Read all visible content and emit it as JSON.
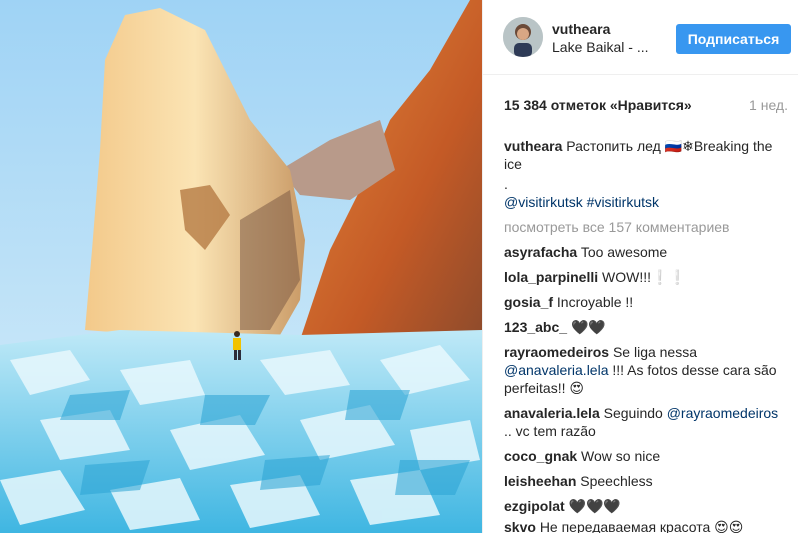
{
  "post": {
    "username": "vutheara",
    "location": "Lake Baikal - ...",
    "follow_label": "Подписаться",
    "likes": "15 384 отметок «Нравится»",
    "time_ago": "1 нед.",
    "caption_text": "Растопить лед 🇷🇺❄Breaking the ice",
    "caption_dot": ".",
    "hashtags": "@visitirkutsk #visitirkutsk",
    "view_all": "посмотреть все 157 комментариев"
  },
  "comments": [
    {
      "user": "asyrafacha",
      "text": "Too awesome"
    },
    {
      "user": "lola_parpinelli",
      "text": "WOW!!!❕❕"
    },
    {
      "user": "gosia_f",
      "text": "Incroyable !!"
    },
    {
      "user": "123_abc_",
      "text": "🖤🖤"
    },
    {
      "user": "rayraomedeiros",
      "text": "Se liga nessa",
      "mention": "@anavaleria.lela",
      "text2": "!!! As fotos desse cara são perfeitas!! 😍"
    },
    {
      "user": "anavaleria.lela",
      "text": "Seguindo",
      "mention": "@rayraomedeiros",
      "text2": ".. vc tem razão"
    },
    {
      "user": "coco_gnak",
      "text": "Wow so nice"
    },
    {
      "user": "leisheehan",
      "text": "Speechless"
    },
    {
      "user": "ezgipolat",
      "text": "🖤🖤🖤"
    },
    {
      "user": "skvo",
      "text": "Не передаваемая красота 😍😍"
    }
  ],
  "colors": {
    "accent": "#3897f0",
    "mention": "#003569",
    "muted": "#999999"
  },
  "icons": {
    "avatar": "user-avatar"
  }
}
